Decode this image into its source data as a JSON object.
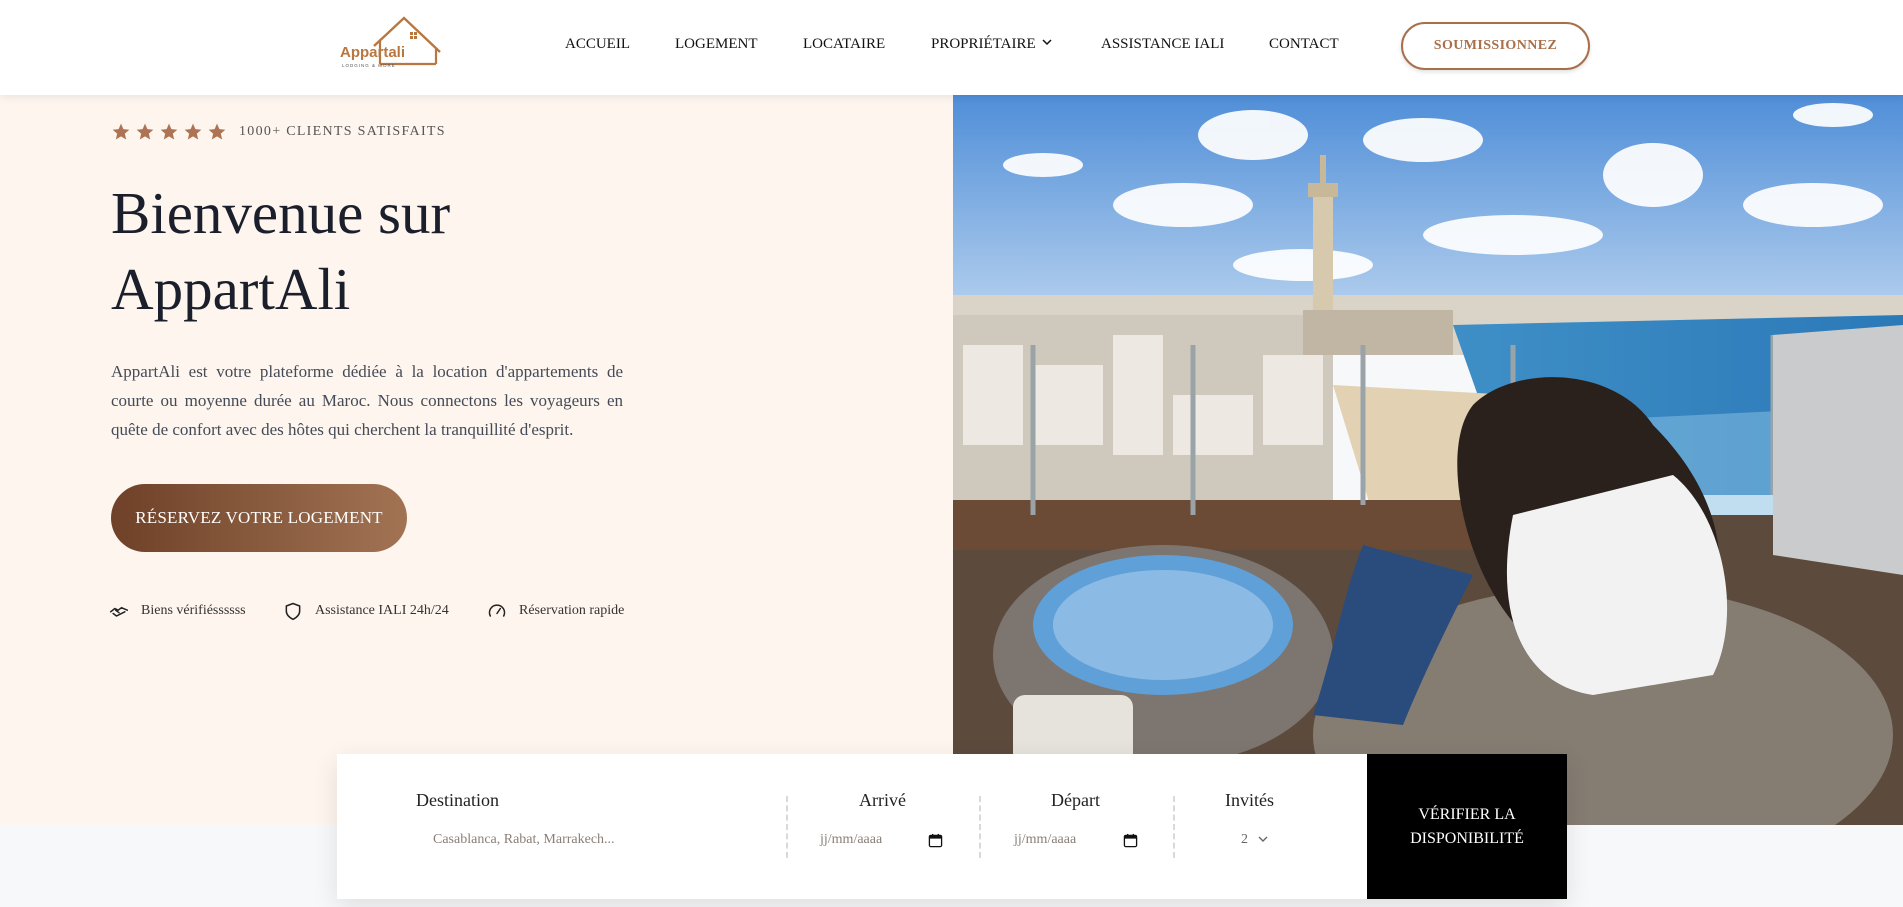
{
  "header": {
    "logo": {
      "text": "Appartali",
      "tagline": "LODGING & MORE"
    },
    "nav": [
      "ACCUEIL",
      "LOGEMENT",
      "LOCATAIRE",
      "PROPRIÉTAIRE",
      "ASSISTANCE IALI",
      "CONTACT"
    ],
    "cta_label": "SOUMISSIONNEZ"
  },
  "hero": {
    "rating_stars": 5,
    "clients_label": "1000+ CLIENTS SATISFAITS",
    "title_line1": "Bienvenue sur",
    "title_line2": "AppartAli",
    "description": "AppartAli est votre plateforme dédiée à la location d'appartements de courte ou moyenne durée au Maroc. Nous connectons les voyageurs en quête de confort avec des hôtes qui cherchent la tranquillité d'esprit.",
    "book_button": "RÉSERVEZ VOTRE LOGEMENT",
    "features": [
      {
        "icon": "handshake-icon",
        "label": "Biens vérifiéssssss"
      },
      {
        "icon": "shield-icon",
        "label": "Assistance IALI 24h/24"
      },
      {
        "icon": "speedometer-icon",
        "label": "Réservation rapide"
      }
    ]
  },
  "search": {
    "destination_label": "Destination",
    "destination_placeholder": "Casablanca, Rabat, Marrakech...",
    "arrival_label": "Arrivé",
    "arrival_placeholder": "jj/mm/aaaa",
    "departure_label": "Départ",
    "departure_placeholder": "jj/mm/aaaa",
    "guests_label": "Invités",
    "guests_value": "2",
    "verify_button": "VÉRIFIER LA DISPONIBILITÉ"
  },
  "colors": {
    "accent": "#a86f4a",
    "hero_bg": "#fdf5ee",
    "dark_button": "#000000",
    "star": "#ad7353"
  }
}
